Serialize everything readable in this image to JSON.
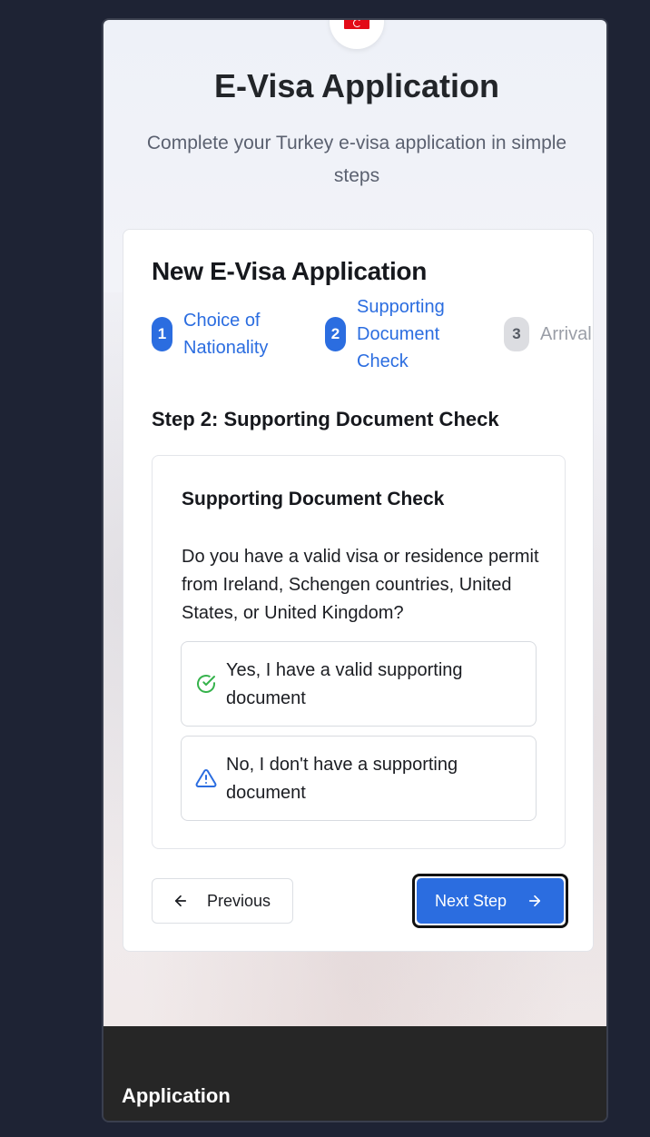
{
  "header": {
    "title": "E-Visa Application",
    "subtitle": "Complete your Turkey e-visa application in simple steps"
  },
  "form": {
    "title": "New E-Visa Application",
    "steps": [
      {
        "number": "1",
        "label": "Choice of Nationality",
        "state": "completed"
      },
      {
        "number": "2",
        "label": "Supporting Document Check",
        "state": "current"
      },
      {
        "number": "3",
        "label": "Arrival Information",
        "state": "upcoming"
      }
    ],
    "step_heading": "Step 2: Supporting Document Check",
    "section": {
      "title": "Supporting Document Check",
      "question": "Do you have a valid visa or residence permit from Ireland, Schengen countries, United States, or United Kingdom?",
      "options": [
        {
          "label": "Yes, I have a valid supporting document",
          "icon": "check-circle-icon"
        },
        {
          "label": "No, I don't have a supporting document",
          "icon": "warning-triangle-icon"
        }
      ]
    },
    "buttons": {
      "previous": "Previous",
      "next": "Next Step"
    }
  },
  "footer": {
    "title": "Application"
  },
  "colors": {
    "accent": "#2b6de0",
    "success": "#35b24b",
    "warning_icon": "#2b6de0",
    "page_background": "#1e2334",
    "footer_background": "#262626"
  }
}
